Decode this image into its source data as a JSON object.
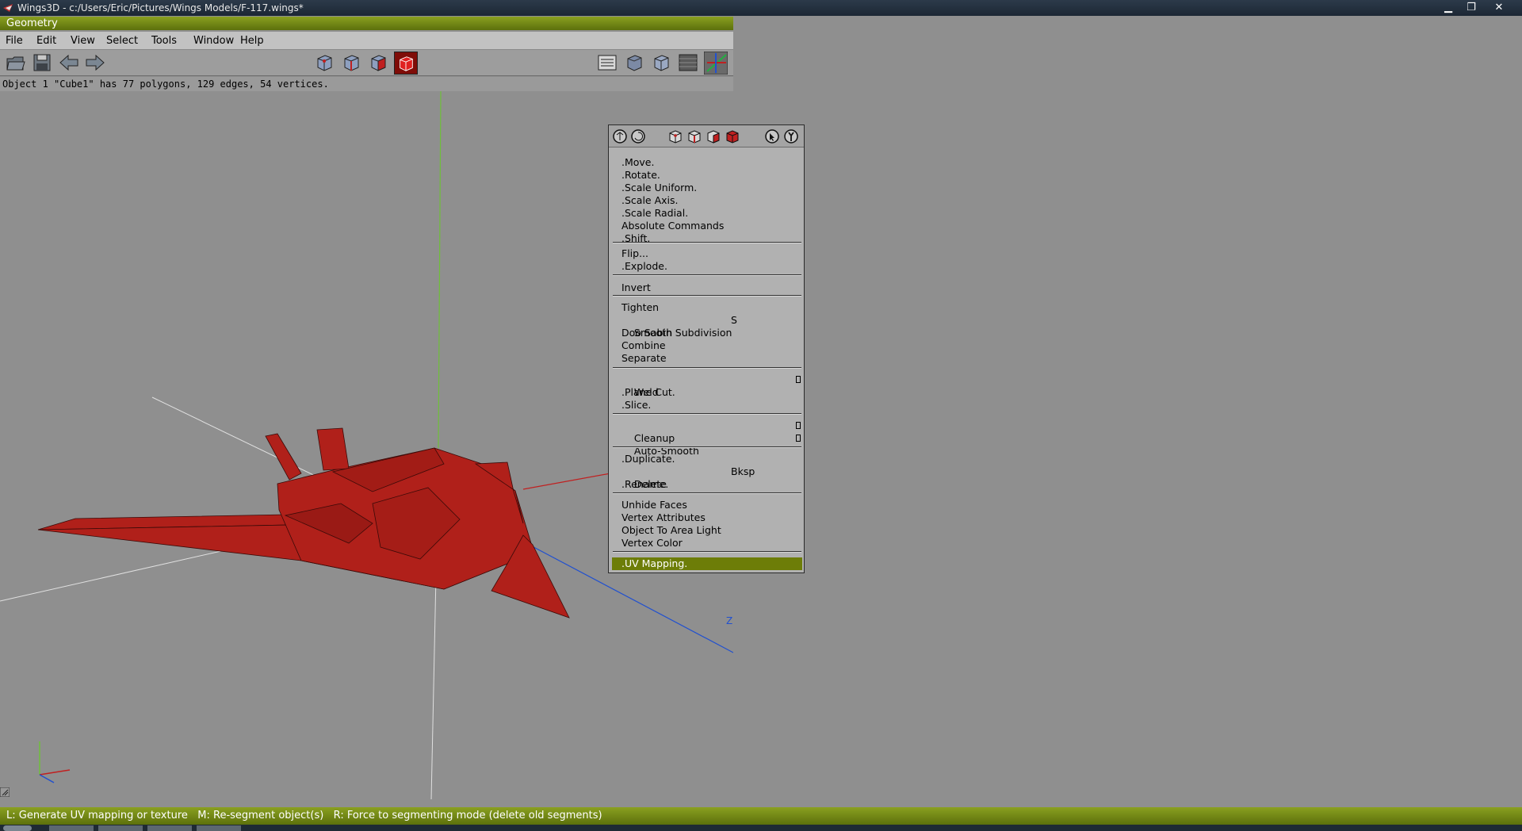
{
  "os": {
    "window_title": "Wings3D - c:/Users/Eric/Pictures/Wings Models/F-117.wings*",
    "minimize": "▁",
    "maximize": "❐",
    "close": "✕"
  },
  "geometry_window": {
    "title": "Geometry",
    "menu": [
      "File",
      "Edit",
      "View",
      "Select",
      "Tools",
      "Window",
      "Help"
    ],
    "toolbar": {
      "file_buttons": [
        "open-icon",
        "save-icon",
        "undo-icon",
        "redo-icon"
      ],
      "selection_modes": [
        "vertex-mode-icon",
        "edge-mode-icon",
        "face-mode-icon",
        "body-mode-icon"
      ],
      "active_selection_mode": "body-mode-icon",
      "view_buttons": [
        "workmode-icon",
        "smooth-preview-icon",
        "wireframe-icon",
        "groundplane-icon",
        "axes-icon"
      ]
    },
    "info": "Object 1 \"Cube1\" has 77 polygons, 129 edges, 54 vertices.",
    "axis_label_z": "Z"
  },
  "context_menu": {
    "header_icons": [
      "rotate-left-icon",
      "rotate-right-icon",
      "vertex-select-icon",
      "edge-select-icon",
      "face-select-icon",
      "body-select-icon",
      "cursor-help-icon",
      "settings-icon"
    ],
    "groups": [
      [
        {
          "label": ".Move."
        },
        {
          "label": ".Rotate."
        },
        {
          "label": ".Scale Uniform."
        },
        {
          "label": ".Scale Axis."
        },
        {
          "label": ".Scale Radial."
        },
        {
          "label": "Absolute Commands"
        },
        {
          "label": ".Shift."
        }
      ],
      [
        {
          "label": "Flip..."
        },
        {
          "label": ".Explode."
        }
      ],
      [
        {
          "label": "Invert"
        }
      ],
      [
        {
          "label": "Tighten"
        },
        {
          "label": "Smooth",
          "shortcut": "S"
        },
        {
          "label": "Doo Sabin Subdivision"
        },
        {
          "label": "Combine"
        },
        {
          "label": "Separate"
        }
      ],
      [
        {
          "label": "Weld",
          "option": true
        },
        {
          "label": ".Plane Cut."
        },
        {
          "label": ".Slice."
        }
      ],
      [
        {
          "label": "Cleanup",
          "option": true
        },
        {
          "label": "Auto-Smooth",
          "option": true
        }
      ],
      [
        {
          "label": ".Duplicate."
        },
        {
          "label": "Delete",
          "shortcut": "Bksp"
        },
        {
          "label": ".Rename."
        }
      ],
      [
        {
          "label": "Unhide Faces"
        },
        {
          "label": "Vertex Attributes"
        },
        {
          "label": "Object To Area Light"
        },
        {
          "label": "Vertex Color"
        }
      ],
      [
        {
          "label": ".UV Mapping.",
          "highlighted": true
        }
      ]
    ]
  },
  "status_bar": "L: Generate UV mapping or texture   M: Re-segment object(s)   R: Force to segmenting mode (delete old segments)",
  "colors": {
    "accent_green": "#6d7d08",
    "model_red": "#b0201a",
    "axis_x": "#c02020",
    "axis_y": "#6fbf3a",
    "axis_z": "#2050d0"
  }
}
